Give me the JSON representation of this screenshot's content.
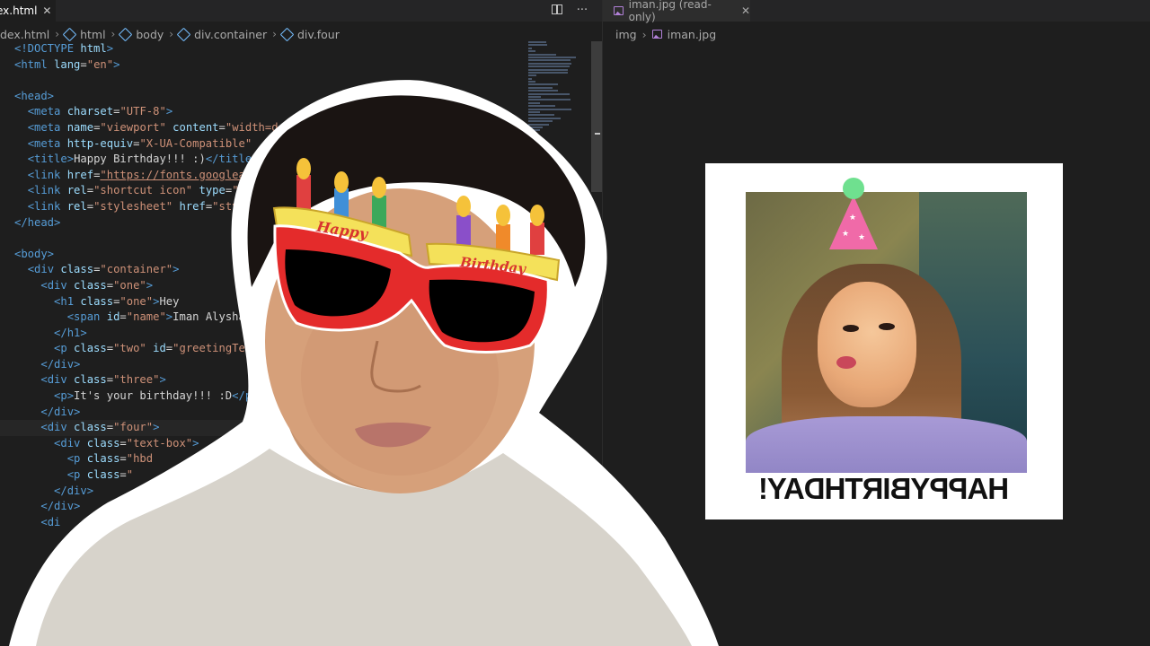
{
  "left_editor": {
    "tab": {
      "label": "index.html",
      "visible_label": "ex.html"
    },
    "breadcrumbs": [
      "dex.html",
      "html",
      "body",
      "div.container",
      "div.four"
    ],
    "code_lines": [
      [
        [
          "tag",
          "<!DOCTYPE "
        ],
        [
          "attr",
          "html"
        ],
        [
          "tag",
          ">"
        ]
      ],
      [
        [
          "tag",
          "<html "
        ],
        [
          "attr",
          "lang"
        ],
        [
          "txt",
          "="
        ],
        [
          "str",
          "\"en\""
        ],
        [
          "tag",
          ">"
        ]
      ],
      [],
      [
        [
          "tag",
          "<head>"
        ]
      ],
      [
        [
          "txt",
          "  "
        ],
        [
          "tag",
          "<meta "
        ],
        [
          "attr",
          "charset"
        ],
        [
          "txt",
          "="
        ],
        [
          "str",
          "\"UTF-8\""
        ],
        [
          "tag",
          ">"
        ]
      ],
      [
        [
          "txt",
          "  "
        ],
        [
          "tag",
          "<meta "
        ],
        [
          "attr",
          "name"
        ],
        [
          "txt",
          "="
        ],
        [
          "str",
          "\"viewport\" "
        ],
        [
          "attr",
          "content"
        ],
        [
          "txt",
          "="
        ],
        [
          "str",
          "\"width=de"
        ]
      ],
      [
        [
          "txt",
          "  "
        ],
        [
          "tag",
          "<meta "
        ],
        [
          "attr",
          "http-equiv"
        ],
        [
          "txt",
          "="
        ],
        [
          "str",
          "\"X-UA-Compatible\""
        ]
      ],
      [
        [
          "txt",
          "  "
        ],
        [
          "tag",
          "<title>"
        ],
        [
          "txt",
          "Happy Birthday!!! :)"
        ],
        [
          "tag",
          "</title>"
        ]
      ],
      [
        [
          "txt",
          "  "
        ],
        [
          "tag",
          "<link "
        ],
        [
          "attr",
          "href"
        ],
        [
          "txt",
          "="
        ],
        [
          "url",
          "\"https://fonts.googlea"
        ]
      ],
      [
        [
          "txt",
          "  "
        ],
        [
          "tag",
          "<link "
        ],
        [
          "attr",
          "rel"
        ],
        [
          "txt",
          "="
        ],
        [
          "str",
          "\"shortcut icon\" "
        ],
        [
          "attr",
          "type"
        ],
        [
          "txt",
          "="
        ],
        [
          "str",
          "\""
        ]
      ],
      [
        [
          "txt",
          "  "
        ],
        [
          "tag",
          "<link "
        ],
        [
          "attr",
          "rel"
        ],
        [
          "txt",
          "="
        ],
        [
          "str",
          "\"stylesheet\" "
        ],
        [
          "attr",
          "href"
        ],
        [
          "txt",
          "="
        ],
        [
          "str",
          "\"sty"
        ]
      ],
      [
        [
          "tag",
          "</head>"
        ]
      ],
      [],
      [
        [
          "tag",
          "<body>"
        ]
      ],
      [
        [
          "txt",
          "  "
        ],
        [
          "tag",
          "<div "
        ],
        [
          "attr",
          "class"
        ],
        [
          "txt",
          "="
        ],
        [
          "str",
          "\"container\""
        ],
        [
          "tag",
          ">"
        ]
      ],
      [
        [
          "txt",
          "    "
        ],
        [
          "tag",
          "<div "
        ],
        [
          "attr",
          "class"
        ],
        [
          "txt",
          "="
        ],
        [
          "str",
          "\"one\""
        ],
        [
          "tag",
          ">"
        ]
      ],
      [
        [
          "txt",
          "      "
        ],
        [
          "tag",
          "<h1 "
        ],
        [
          "attr",
          "class"
        ],
        [
          "txt",
          "="
        ],
        [
          "str",
          "\"one\""
        ],
        [
          "tag",
          ">"
        ],
        [
          "txt",
          "Hey"
        ]
      ],
      [
        [
          "txt",
          "        "
        ],
        [
          "tag",
          "<span "
        ],
        [
          "attr",
          "id"
        ],
        [
          "txt",
          "="
        ],
        [
          "str",
          "\"name\""
        ],
        [
          "tag",
          ">"
        ],
        [
          "txt",
          "Iman Alysha"
        ]
      ],
      [
        [
          "txt",
          "      "
        ],
        [
          "tag",
          "</h1>"
        ]
      ],
      [
        [
          "txt",
          "      "
        ],
        [
          "tag",
          "<p "
        ],
        [
          "attr",
          "class"
        ],
        [
          "txt",
          "="
        ],
        [
          "str",
          "\"two\" "
        ],
        [
          "attr",
          "id"
        ],
        [
          "txt",
          "="
        ],
        [
          "str",
          "\"greetingTex"
        ]
      ],
      [
        [
          "txt",
          "    "
        ],
        [
          "tag",
          "</div>"
        ]
      ],
      [
        [
          "txt",
          "    "
        ],
        [
          "tag",
          "<div "
        ],
        [
          "attr",
          "class"
        ],
        [
          "txt",
          "="
        ],
        [
          "str",
          "\"three\""
        ],
        [
          "tag",
          ">"
        ]
      ],
      [
        [
          "txt",
          "      "
        ],
        [
          "tag",
          "<p>"
        ],
        [
          "txt",
          "It's your birthday!!! :D"
        ],
        [
          "tag",
          "</p>"
        ]
      ],
      [
        [
          "txt",
          "    "
        ],
        [
          "tag",
          "</div>"
        ]
      ],
      [
        [
          "txt",
          "    "
        ],
        [
          "tag",
          "<div "
        ],
        [
          "attr",
          "class"
        ],
        [
          "txt",
          "="
        ],
        [
          "str",
          "\"four\""
        ],
        [
          "tag",
          ">"
        ]
      ],
      [
        [
          "txt",
          "      "
        ],
        [
          "tag",
          "<div "
        ],
        [
          "attr",
          "class"
        ],
        [
          "txt",
          "="
        ],
        [
          "str",
          "\"text-box\""
        ],
        [
          "tag",
          ">"
        ]
      ],
      [
        [
          "txt",
          "        "
        ],
        [
          "tag",
          "<p "
        ],
        [
          "attr",
          "class"
        ],
        [
          "txt",
          "="
        ],
        [
          "str",
          "\"hbd"
        ]
      ],
      [
        [
          "txt",
          "        "
        ],
        [
          "tag",
          "<p "
        ],
        [
          "attr",
          "class"
        ],
        [
          "txt",
          "="
        ],
        [
          "str",
          "\""
        ]
      ],
      [
        [
          "txt",
          "      "
        ],
        [
          "tag",
          "</div>"
        ]
      ],
      [
        [
          "txt",
          "    "
        ],
        [
          "tag",
          "</div>"
        ]
      ],
      [
        [
          "txt",
          "    "
        ],
        [
          "tag",
          "<di"
        ]
      ]
    ],
    "current_line_index": 24
  },
  "right_editor": {
    "tab": {
      "label": "iman.jpg (read-only)"
    },
    "breadcrumbs": [
      "img",
      "iman.jpg"
    ],
    "preview": {
      "caption": "HAPPYBIRTHDAY!",
      "caption_mirrored": true
    }
  },
  "overlay": {
    "glasses_text_left": "Happy",
    "glasses_text_right": "Birthday"
  },
  "colors": {
    "editor_bg": "#1e1e1e",
    "tag": "#569cd6",
    "attr": "#9cdcfe",
    "string": "#ce9178",
    "text": "#d4d4d4"
  }
}
